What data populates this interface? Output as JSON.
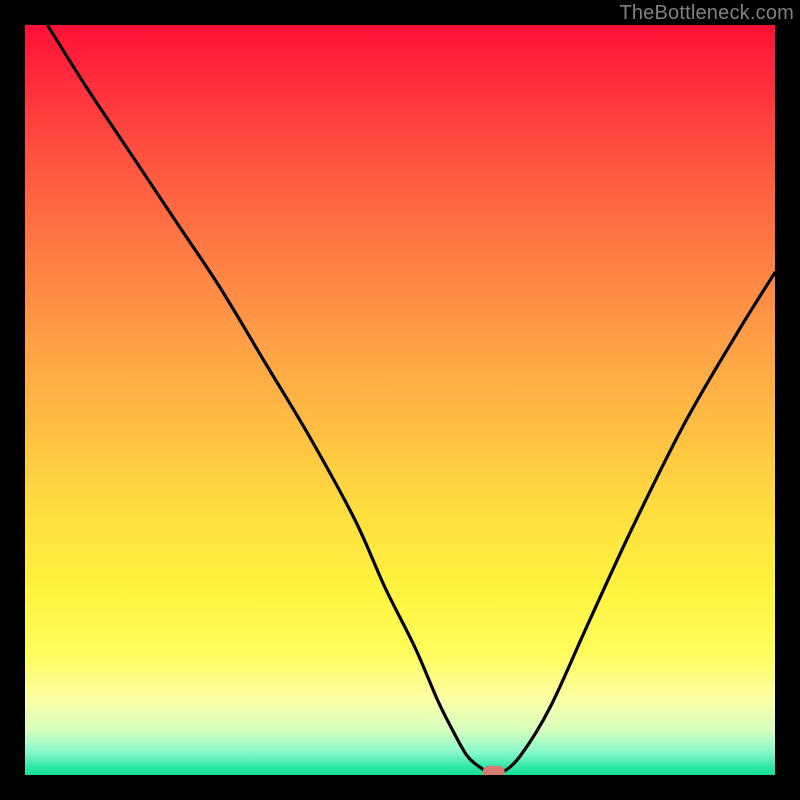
{
  "watermark": "TheBottleneck.com",
  "gradient": {
    "top": "#ff1037",
    "mid": "#ffde40",
    "bottom": "#13e098"
  },
  "marker_color": "#d77a6f",
  "chart_data": {
    "type": "line",
    "title": "",
    "xlabel": "",
    "ylabel": "",
    "xlim": [
      0,
      100
    ],
    "ylim": [
      0,
      100
    ],
    "series": [
      {
        "name": "bottleneck-curve",
        "x": [
          3,
          8,
          14,
          20,
          26,
          32,
          38,
          44,
          48,
          52,
          55,
          57,
          59,
          61,
          62,
          63.5,
          66,
          70,
          75,
          81,
          88,
          95,
          100
        ],
        "y": [
          100,
          92,
          83,
          74,
          65,
          55,
          45,
          34,
          25,
          17,
          10,
          6,
          2.5,
          0.8,
          0.3,
          0.3,
          2.5,
          9,
          20,
          33,
          47,
          59,
          67
        ]
      }
    ],
    "annotations": [
      {
        "name": "minimum-marker",
        "x": 62.5,
        "y": 0.3
      }
    ]
  }
}
